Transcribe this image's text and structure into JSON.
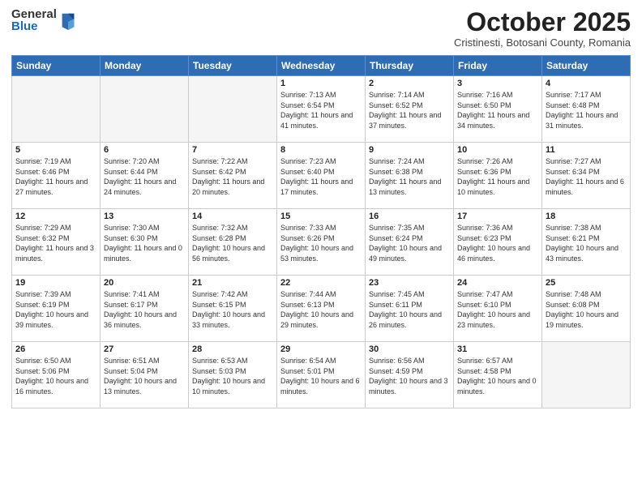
{
  "logo": {
    "general": "General",
    "blue": "Blue",
    "tagline": ""
  },
  "header": {
    "month": "October 2025",
    "location": "Cristinesti, Botosani County, Romania"
  },
  "days_of_week": [
    "Sunday",
    "Monday",
    "Tuesday",
    "Wednesday",
    "Thursday",
    "Friday",
    "Saturday"
  ],
  "weeks": [
    [
      {
        "day": "",
        "info": ""
      },
      {
        "day": "",
        "info": ""
      },
      {
        "day": "",
        "info": ""
      },
      {
        "day": "1",
        "info": "Sunrise: 7:13 AM\nSunset: 6:54 PM\nDaylight: 11 hours and 41 minutes."
      },
      {
        "day": "2",
        "info": "Sunrise: 7:14 AM\nSunset: 6:52 PM\nDaylight: 11 hours and 37 minutes."
      },
      {
        "day": "3",
        "info": "Sunrise: 7:16 AM\nSunset: 6:50 PM\nDaylight: 11 hours and 34 minutes."
      },
      {
        "day": "4",
        "info": "Sunrise: 7:17 AM\nSunset: 6:48 PM\nDaylight: 11 hours and 31 minutes."
      }
    ],
    [
      {
        "day": "5",
        "info": "Sunrise: 7:19 AM\nSunset: 6:46 PM\nDaylight: 11 hours and 27 minutes."
      },
      {
        "day": "6",
        "info": "Sunrise: 7:20 AM\nSunset: 6:44 PM\nDaylight: 11 hours and 24 minutes."
      },
      {
        "day": "7",
        "info": "Sunrise: 7:22 AM\nSunset: 6:42 PM\nDaylight: 11 hours and 20 minutes."
      },
      {
        "day": "8",
        "info": "Sunrise: 7:23 AM\nSunset: 6:40 PM\nDaylight: 11 hours and 17 minutes."
      },
      {
        "day": "9",
        "info": "Sunrise: 7:24 AM\nSunset: 6:38 PM\nDaylight: 11 hours and 13 minutes."
      },
      {
        "day": "10",
        "info": "Sunrise: 7:26 AM\nSunset: 6:36 PM\nDaylight: 11 hours and 10 minutes."
      },
      {
        "day": "11",
        "info": "Sunrise: 7:27 AM\nSunset: 6:34 PM\nDaylight: 11 hours and 6 minutes."
      }
    ],
    [
      {
        "day": "12",
        "info": "Sunrise: 7:29 AM\nSunset: 6:32 PM\nDaylight: 11 hours and 3 minutes."
      },
      {
        "day": "13",
        "info": "Sunrise: 7:30 AM\nSunset: 6:30 PM\nDaylight: 11 hours and 0 minutes."
      },
      {
        "day": "14",
        "info": "Sunrise: 7:32 AM\nSunset: 6:28 PM\nDaylight: 10 hours and 56 minutes."
      },
      {
        "day": "15",
        "info": "Sunrise: 7:33 AM\nSunset: 6:26 PM\nDaylight: 10 hours and 53 minutes."
      },
      {
        "day": "16",
        "info": "Sunrise: 7:35 AM\nSunset: 6:24 PM\nDaylight: 10 hours and 49 minutes."
      },
      {
        "day": "17",
        "info": "Sunrise: 7:36 AM\nSunset: 6:23 PM\nDaylight: 10 hours and 46 minutes."
      },
      {
        "day": "18",
        "info": "Sunrise: 7:38 AM\nSunset: 6:21 PM\nDaylight: 10 hours and 43 minutes."
      }
    ],
    [
      {
        "day": "19",
        "info": "Sunrise: 7:39 AM\nSunset: 6:19 PM\nDaylight: 10 hours and 39 minutes."
      },
      {
        "day": "20",
        "info": "Sunrise: 7:41 AM\nSunset: 6:17 PM\nDaylight: 10 hours and 36 minutes."
      },
      {
        "day": "21",
        "info": "Sunrise: 7:42 AM\nSunset: 6:15 PM\nDaylight: 10 hours and 33 minutes."
      },
      {
        "day": "22",
        "info": "Sunrise: 7:44 AM\nSunset: 6:13 PM\nDaylight: 10 hours and 29 minutes."
      },
      {
        "day": "23",
        "info": "Sunrise: 7:45 AM\nSunset: 6:11 PM\nDaylight: 10 hours and 26 minutes."
      },
      {
        "day": "24",
        "info": "Sunrise: 7:47 AM\nSunset: 6:10 PM\nDaylight: 10 hours and 23 minutes."
      },
      {
        "day": "25",
        "info": "Sunrise: 7:48 AM\nSunset: 6:08 PM\nDaylight: 10 hours and 19 minutes."
      }
    ],
    [
      {
        "day": "26",
        "info": "Sunrise: 6:50 AM\nSunset: 5:06 PM\nDaylight: 10 hours and 16 minutes."
      },
      {
        "day": "27",
        "info": "Sunrise: 6:51 AM\nSunset: 5:04 PM\nDaylight: 10 hours and 13 minutes."
      },
      {
        "day": "28",
        "info": "Sunrise: 6:53 AM\nSunset: 5:03 PM\nDaylight: 10 hours and 10 minutes."
      },
      {
        "day": "29",
        "info": "Sunrise: 6:54 AM\nSunset: 5:01 PM\nDaylight: 10 hours and 6 minutes."
      },
      {
        "day": "30",
        "info": "Sunrise: 6:56 AM\nSunset: 4:59 PM\nDaylight: 10 hours and 3 minutes."
      },
      {
        "day": "31",
        "info": "Sunrise: 6:57 AM\nSunset: 4:58 PM\nDaylight: 10 hours and 0 minutes."
      },
      {
        "day": "",
        "info": ""
      }
    ]
  ]
}
